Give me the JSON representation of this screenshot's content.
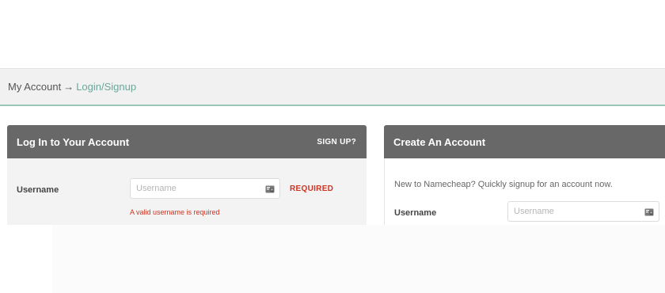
{
  "breadcrumb": {
    "parent": "My Account",
    "arrow": "→",
    "current": "Login/Signup"
  },
  "login_panel": {
    "title": "Log In to Your Account",
    "signup_link": "SIGN UP?",
    "username_label": "Username",
    "username_placeholder": "Username",
    "username_value": "",
    "required_tag": "REQUIRED",
    "error_message": "A valid username is required"
  },
  "create_panel": {
    "title": "Create An Account",
    "intro": "New to Namecheap? Quickly signup for an account now.",
    "username_label": "Username",
    "username_placeholder": "Username",
    "username_value": ""
  },
  "colors": {
    "panel_header": "#686868",
    "accent_green": "#6aa89a",
    "error_red": "#cc3322"
  },
  "icons": {
    "field_icon": "id-card-icon"
  }
}
